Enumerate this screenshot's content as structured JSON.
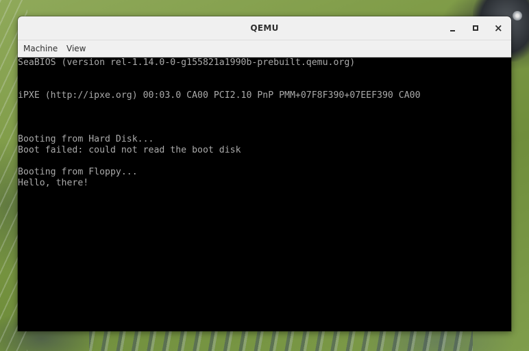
{
  "window": {
    "title": "QEMU",
    "controls": {
      "minimize": "minimize-icon",
      "maximize": "maximize-icon",
      "close": "close-icon"
    }
  },
  "menubar": {
    "items": [
      {
        "label": "Machine"
      },
      {
        "label": "View"
      }
    ]
  },
  "console": {
    "lines": [
      "SeaBIOS (version rel-1.14.0-0-g155821a1990b-prebuilt.qemu.org)",
      "",
      "",
      "iPXE (http://ipxe.org) 00:03.0 CA00 PCI2.10 PnP PMM+07F8F390+07EEF390 CA00",
      "",
      "",
      "",
      "Booting from Hard Disk...",
      "Boot failed: could not read the boot disk",
      "",
      "Booting from Floppy...",
      "Hello, there!"
    ],
    "text_color": "#aaaaaa",
    "background": "#000000"
  }
}
